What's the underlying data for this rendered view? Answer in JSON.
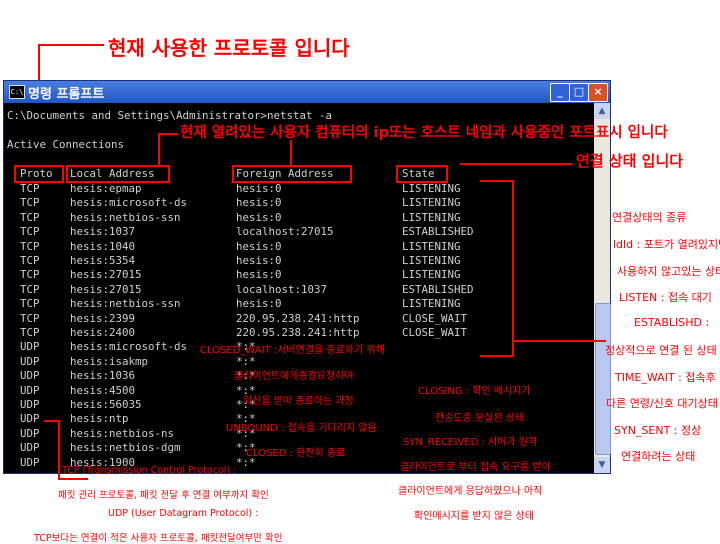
{
  "top_annotation": "현재 사용한 프로토콜 입니다",
  "window": {
    "title": "명령 프롬프트",
    "icon_text": "C:\\",
    "minimize": "_",
    "maximize": "□",
    "close": "×"
  },
  "terminal": {
    "command": "C:\\Documents and Settings\\Administrator>netstat -a",
    "active_connections": "Active Connections",
    "headers": {
      "proto": "Proto",
      "local": "Local Address",
      "foreign": "Foreign Address",
      "state": "State"
    },
    "rows": [
      {
        "proto": "TCP",
        "local": "hesis:epmap",
        "foreign": "hesis:0",
        "state": "LISTENING"
      },
      {
        "proto": "TCP",
        "local": "hesis:microsoft-ds",
        "foreign": "hesis:0",
        "state": "LISTENING"
      },
      {
        "proto": "TCP",
        "local": "hesis:netbios-ssn",
        "foreign": "hesis:0",
        "state": "LISTENING"
      },
      {
        "proto": "TCP",
        "local": "hesis:1037",
        "foreign": "localhost:27015",
        "state": "ESTABLISHED"
      },
      {
        "proto": "TCP",
        "local": "hesis:1040",
        "foreign": "hesis:0",
        "state": "LISTENING"
      },
      {
        "proto": "TCP",
        "local": "hesis:5354",
        "foreign": "hesis:0",
        "state": "LISTENING"
      },
      {
        "proto": "TCP",
        "local": "hesis:27015",
        "foreign": "hesis:0",
        "state": "LISTENING"
      },
      {
        "proto": "TCP",
        "local": "hesis:27015",
        "foreign": "localhost:1037",
        "state": "ESTABLISHED"
      },
      {
        "proto": "TCP",
        "local": "hesis:netbios-ssn",
        "foreign": "hesis:0",
        "state": "LISTENING"
      },
      {
        "proto": "TCP",
        "local": "hesis:2399",
        "foreign": "220.95.238.241:http",
        "state": "CLOSE_WAIT"
      },
      {
        "proto": "TCP",
        "local": "hesis:2400",
        "foreign": "220.95.238.241:http",
        "state": "CLOSE_WAIT"
      },
      {
        "proto": "UDP",
        "local": "hesis:microsoft-ds",
        "foreign": "*:*",
        "state": ""
      },
      {
        "proto": "UDP",
        "local": "hesis:isakmp",
        "foreign": "*:*",
        "state": ""
      },
      {
        "proto": "UDP",
        "local": "hesis:1036",
        "foreign": "*:*",
        "state": ""
      },
      {
        "proto": "UDP",
        "local": "hesis:4500",
        "foreign": "*:*",
        "state": ""
      },
      {
        "proto": "UDP",
        "local": "hesis:56035",
        "foreign": "*:*",
        "state": ""
      },
      {
        "proto": "UDP",
        "local": "hesis:ntp",
        "foreign": "*:*",
        "state": ""
      },
      {
        "proto": "UDP",
        "local": "hesis:netbios-ns",
        "foreign": "*:*",
        "state": ""
      },
      {
        "proto": "UDP",
        "local": "hesis:netbios-dgm",
        "foreign": "*:*",
        "state": ""
      },
      {
        "proto": "UDP",
        "local": "hesis:1900",
        "foreign": "*:*",
        "state": ""
      }
    ]
  },
  "annotations": {
    "address_note": "현재 열려있는 사용자 컴퓨터의 ip또는 호스트 네임과 사용중인 포트표시 입니다",
    "state_note": "연결 상태 입니다",
    "state_types_title": "연결상태의 종류",
    "state_types": [
      "ldld : 포트가 열려있지만",
      "사용하지 않고있는 상태",
      "LISTEN : 접속 대기",
      "ESTABLISHD :",
      "정상적으로 연결 된 상태",
      "TIME_WAIT : 접속후",
      "다른 연령/신호 대기상태",
      "SYN_SENT : 정상",
      "연결하려는 상태"
    ],
    "closed_wait": [
      "CLOSED_WAIT :서버연결을 종료하기 위해",
      "클라이언트에게종결요청하며",
      "회신을 받아 종료하는 과정"
    ],
    "closing": [
      "CLOSING : 확인 메시지가",
      "전송도중 분실된 상태"
    ],
    "unbound": "UNBOUND : 접속을 기다리지 않음",
    "closed": "CLOSED : 완전히 종료",
    "syn_received": [
      "SYN_RECEIVED : 서버가 원격",
      "클라이언트로 부터 접속 요구를 받아",
      "클라이언트에게 응답하였으나 아직",
      "확인메시지를 받지 않은 상태"
    ],
    "tcp_note": [
      "TCP (Transmission Control Protocol) :",
      "패킷 관리 프로토콜, 패킷 전달 후 연결 여부까지 확인",
      "UDP (User Datagram Protocol) :",
      "TCP보다는 연결이 적은 사용자 프로토콜, 패킷전달여부만 확인"
    ]
  },
  "colors": {
    "annotation": "#ff0000",
    "titlebar": "#1f55c8",
    "console_bg": "#000000",
    "console_text": "#d0d0d0"
  }
}
